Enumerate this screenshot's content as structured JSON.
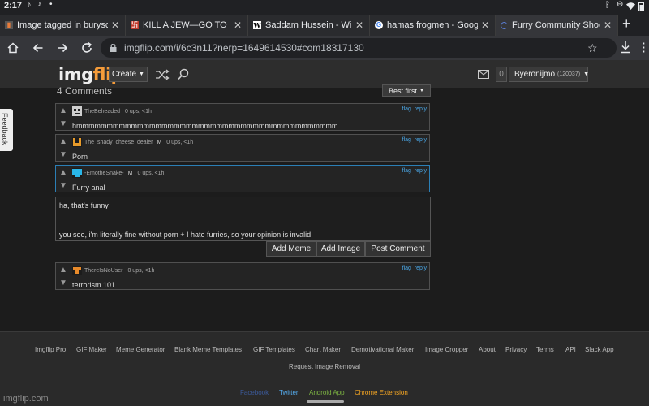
{
  "status": {
    "time": "2:17"
  },
  "tabs": [
    {
      "title": "Image tagged in burysch",
      "favicon": "imgflip",
      "active": false
    },
    {
      "title": "KILL A JEW—GO TO HEA",
      "favicon": "red-box",
      "active": false
    },
    {
      "title": "Saddam Hussein - Wikip",
      "favicon": "wikipedia",
      "active": false
    },
    {
      "title": "hamas frogmen - Google",
      "favicon": "google",
      "active": false
    },
    {
      "title": "Furry Community Shocke",
      "favicon": "loading",
      "active": true
    }
  ],
  "browser": {
    "url": "imgflip.com/i/6c3n11?nerp=1649614530#com18317130"
  },
  "site": {
    "logo_left": "img",
    "logo_right": "flip",
    "create_label": "Create",
    "notif_count": "0",
    "username": "Byeronijmo",
    "user_points": "(120037)"
  },
  "comments_header": {
    "count_label": "4 Comments",
    "sort_label": "Best first"
  },
  "comments": [
    {
      "user": "TheBeheaded",
      "meta": "0 ups, <1h",
      "mod": "",
      "text": "hmmmmmmmmmmmmmmmmmmmmmmmmmmmmmmmmmmmmmmmmmmm",
      "flag": "flag",
      "reply": "reply",
      "avatar_color": "#cfcfcf"
    },
    {
      "user": "The_shady_cheese_dealer",
      "mod": "M",
      "meta": "0 ups, <1h",
      "text": "Porn",
      "flag": "flag",
      "reply": "reply",
      "avatar_color": "#e89b2a"
    },
    {
      "user": "-EmotheSnake-",
      "mod": "M",
      "meta": "0 ups, <1h",
      "text": "Furry anal",
      "flag": "flag",
      "reply": "reply",
      "avatar_color": "#29b6e8"
    }
  ],
  "reply_box": {
    "line1": "ha, that's funny",
    "line2": "you see, i'm literally fine without porn + I hate furries, so your opinion is invalid",
    "add_meme": "Add Meme",
    "add_image": "Add Image",
    "post_comment": "Post Comment"
  },
  "last_comment": {
    "user": "ThereIsNoUser",
    "meta": "0 ups, <1h",
    "text": "terrorism 101",
    "flag": "flag",
    "reply": "reply",
    "avatar_color": "#e88a2a"
  },
  "feedback_tab": "Feedback",
  "footer": {
    "links_row1": [
      "Imgflip Pro",
      "GIF Maker",
      "Meme Generator",
      "Blank Meme Templates",
      "GIF Templates",
      "Chart Maker",
      "Demotivational Maker",
      "Image Cropper",
      "About",
      "Privacy",
      "Terms",
      "API",
      "Slack App"
    ],
    "request_removal": "Request Image Removal",
    "social": [
      {
        "label": "Facebook",
        "color": "#3b5998"
      },
      {
        "label": "Twitter",
        "color": "#55acee"
      },
      {
        "label": "Android App",
        "color": "#7cb342"
      },
      {
        "label": "Chrome Extension",
        "color": "#f5a623"
      }
    ],
    "watermark": "imgflip.com"
  }
}
